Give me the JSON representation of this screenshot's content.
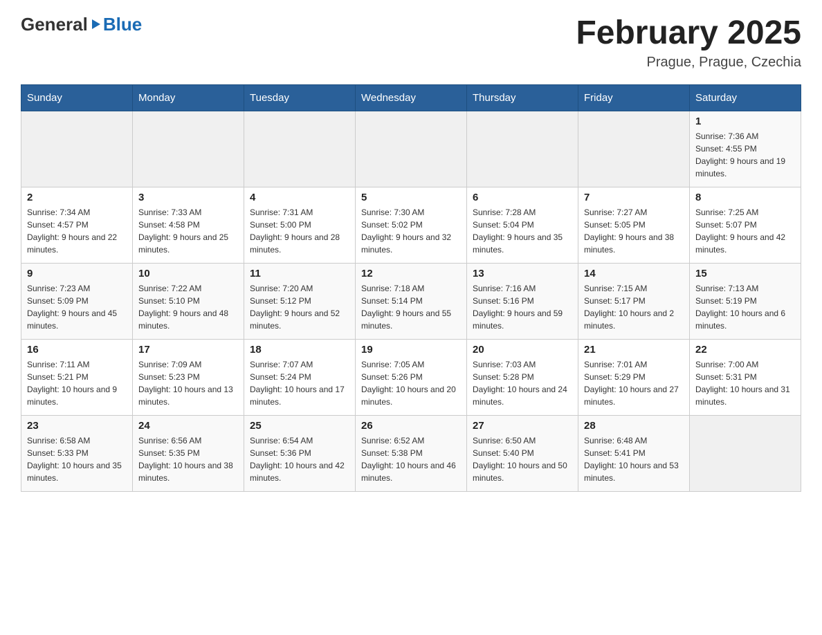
{
  "header": {
    "logo_general": "General",
    "logo_blue": "Blue",
    "month_title": "February 2025",
    "location": "Prague, Prague, Czechia"
  },
  "weekdays": [
    "Sunday",
    "Monday",
    "Tuesday",
    "Wednesday",
    "Thursday",
    "Friday",
    "Saturday"
  ],
  "weeks": [
    [
      {
        "day": "",
        "info": ""
      },
      {
        "day": "",
        "info": ""
      },
      {
        "day": "",
        "info": ""
      },
      {
        "day": "",
        "info": ""
      },
      {
        "day": "",
        "info": ""
      },
      {
        "day": "",
        "info": ""
      },
      {
        "day": "1",
        "info": "Sunrise: 7:36 AM\nSunset: 4:55 PM\nDaylight: 9 hours and 19 minutes."
      }
    ],
    [
      {
        "day": "2",
        "info": "Sunrise: 7:34 AM\nSunset: 4:57 PM\nDaylight: 9 hours and 22 minutes."
      },
      {
        "day": "3",
        "info": "Sunrise: 7:33 AM\nSunset: 4:58 PM\nDaylight: 9 hours and 25 minutes."
      },
      {
        "day": "4",
        "info": "Sunrise: 7:31 AM\nSunset: 5:00 PM\nDaylight: 9 hours and 28 minutes."
      },
      {
        "day": "5",
        "info": "Sunrise: 7:30 AM\nSunset: 5:02 PM\nDaylight: 9 hours and 32 minutes."
      },
      {
        "day": "6",
        "info": "Sunrise: 7:28 AM\nSunset: 5:04 PM\nDaylight: 9 hours and 35 minutes."
      },
      {
        "day": "7",
        "info": "Sunrise: 7:27 AM\nSunset: 5:05 PM\nDaylight: 9 hours and 38 minutes."
      },
      {
        "day": "8",
        "info": "Sunrise: 7:25 AM\nSunset: 5:07 PM\nDaylight: 9 hours and 42 minutes."
      }
    ],
    [
      {
        "day": "9",
        "info": "Sunrise: 7:23 AM\nSunset: 5:09 PM\nDaylight: 9 hours and 45 minutes."
      },
      {
        "day": "10",
        "info": "Sunrise: 7:22 AM\nSunset: 5:10 PM\nDaylight: 9 hours and 48 minutes."
      },
      {
        "day": "11",
        "info": "Sunrise: 7:20 AM\nSunset: 5:12 PM\nDaylight: 9 hours and 52 minutes."
      },
      {
        "day": "12",
        "info": "Sunrise: 7:18 AM\nSunset: 5:14 PM\nDaylight: 9 hours and 55 minutes."
      },
      {
        "day": "13",
        "info": "Sunrise: 7:16 AM\nSunset: 5:16 PM\nDaylight: 9 hours and 59 minutes."
      },
      {
        "day": "14",
        "info": "Sunrise: 7:15 AM\nSunset: 5:17 PM\nDaylight: 10 hours and 2 minutes."
      },
      {
        "day": "15",
        "info": "Sunrise: 7:13 AM\nSunset: 5:19 PM\nDaylight: 10 hours and 6 minutes."
      }
    ],
    [
      {
        "day": "16",
        "info": "Sunrise: 7:11 AM\nSunset: 5:21 PM\nDaylight: 10 hours and 9 minutes."
      },
      {
        "day": "17",
        "info": "Sunrise: 7:09 AM\nSunset: 5:23 PM\nDaylight: 10 hours and 13 minutes."
      },
      {
        "day": "18",
        "info": "Sunrise: 7:07 AM\nSunset: 5:24 PM\nDaylight: 10 hours and 17 minutes."
      },
      {
        "day": "19",
        "info": "Sunrise: 7:05 AM\nSunset: 5:26 PM\nDaylight: 10 hours and 20 minutes."
      },
      {
        "day": "20",
        "info": "Sunrise: 7:03 AM\nSunset: 5:28 PM\nDaylight: 10 hours and 24 minutes."
      },
      {
        "day": "21",
        "info": "Sunrise: 7:01 AM\nSunset: 5:29 PM\nDaylight: 10 hours and 27 minutes."
      },
      {
        "day": "22",
        "info": "Sunrise: 7:00 AM\nSunset: 5:31 PM\nDaylight: 10 hours and 31 minutes."
      }
    ],
    [
      {
        "day": "23",
        "info": "Sunrise: 6:58 AM\nSunset: 5:33 PM\nDaylight: 10 hours and 35 minutes."
      },
      {
        "day": "24",
        "info": "Sunrise: 6:56 AM\nSunset: 5:35 PM\nDaylight: 10 hours and 38 minutes."
      },
      {
        "day": "25",
        "info": "Sunrise: 6:54 AM\nSunset: 5:36 PM\nDaylight: 10 hours and 42 minutes."
      },
      {
        "day": "26",
        "info": "Sunrise: 6:52 AM\nSunset: 5:38 PM\nDaylight: 10 hours and 46 minutes."
      },
      {
        "day": "27",
        "info": "Sunrise: 6:50 AM\nSunset: 5:40 PM\nDaylight: 10 hours and 50 minutes."
      },
      {
        "day": "28",
        "info": "Sunrise: 6:48 AM\nSunset: 5:41 PM\nDaylight: 10 hours and 53 minutes."
      },
      {
        "day": "",
        "info": ""
      }
    ]
  ]
}
